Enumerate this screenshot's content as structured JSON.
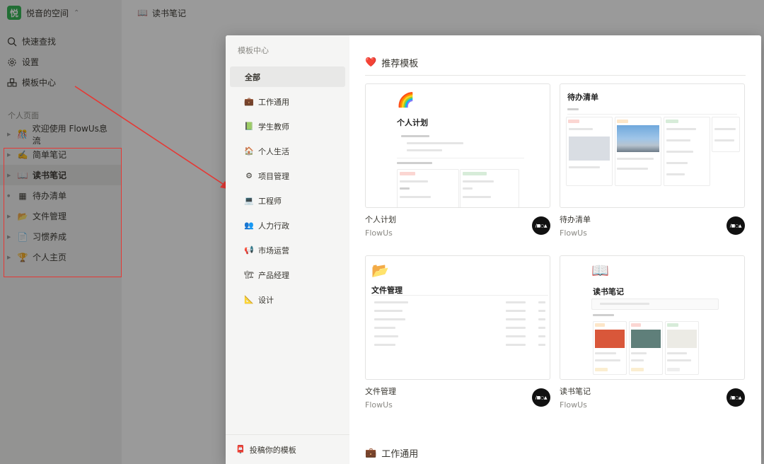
{
  "workspace": {
    "logo_char": "悦",
    "name": "悦音的空间"
  },
  "sidebar": {
    "menu": [
      {
        "label": "快速查找",
        "icon": "search-icon"
      },
      {
        "label": "设置",
        "icon": "gear-icon"
      },
      {
        "label": "模板中心",
        "icon": "template-icon"
      }
    ],
    "section_label": "个人页面",
    "pages": [
      {
        "label": "欢迎使用 FlowUs息流",
        "emoji": "🎊"
      },
      {
        "label": "简单笔记",
        "emoji": "✍️"
      },
      {
        "label": "读书笔记",
        "emoji": "📖",
        "active": true
      },
      {
        "label": "待办清单",
        "emoji": "▦"
      },
      {
        "label": "文件管理",
        "emoji": "📂"
      },
      {
        "label": "习惯养成",
        "emoji": "📄"
      },
      {
        "label": "个人主页",
        "emoji": "🏆"
      }
    ]
  },
  "topbar": {
    "emoji": "📖",
    "title": "读书笔记"
  },
  "modal": {
    "categories_title": "模板中心",
    "categories": [
      {
        "label": "全部",
        "emoji": "",
        "active": true
      },
      {
        "label": "工作通用",
        "emoji": "💼"
      },
      {
        "label": "学生教师",
        "emoji": "📗"
      },
      {
        "label": "个人生活",
        "emoji": "🏠"
      },
      {
        "label": "项目管理",
        "emoji": "⚙"
      },
      {
        "label": "工程师",
        "emoji": "💻"
      },
      {
        "label": "人力行政",
        "emoji": "👥"
      },
      {
        "label": "市场运营",
        "emoji": "📢"
      },
      {
        "label": "产品经理",
        "emoji": "🏗"
      },
      {
        "label": "设计",
        "emoji": "📐"
      }
    ],
    "submit_label": "投稿你的模板",
    "submit_icon": "📮",
    "recommended": {
      "heading": "推荐模板",
      "icon": "❤️"
    },
    "templates": [
      {
        "title": "个人计划",
        "author": "FlowUs",
        "preview_title": "个人计划",
        "preview_emoji": "🌈"
      },
      {
        "title": "待办清单",
        "author": "FlowUs",
        "preview_title": "待办清单",
        "preview_emoji": ""
      },
      {
        "title": "文件管理",
        "author": "FlowUs",
        "preview_title": "文件管理",
        "preview_emoji": "📂"
      },
      {
        "title": "读书笔记",
        "author": "FlowUs",
        "preview_title": "读书笔记",
        "preview_emoji": "📖"
      }
    ],
    "badge_text": "/■○▲",
    "second_section": {
      "heading": "工作通用",
      "icon": "💼"
    }
  },
  "colors": {
    "annotation_red": "#e53935",
    "workspace_logo": "#2fb350"
  }
}
